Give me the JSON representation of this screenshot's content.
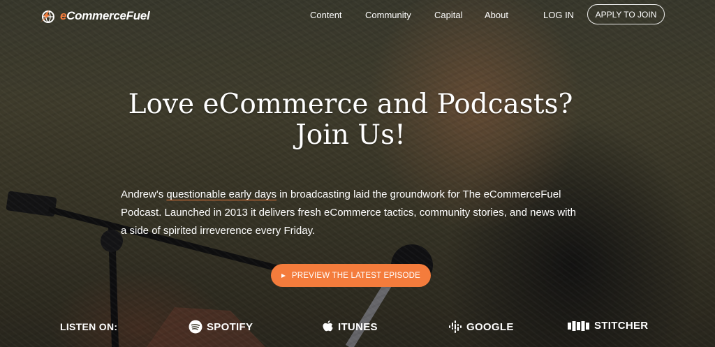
{
  "header": {
    "logo": {
      "prefix": "e",
      "rest": "CommerceFuel"
    },
    "nav": [
      "Content",
      "Community",
      "Capital",
      "About"
    ],
    "login": "LOG IN",
    "apply": "APPLY TO JOIN"
  },
  "hero": {
    "title_line1": "Love eCommerce and Podcasts?",
    "title_line2": "Join Us!",
    "description": {
      "before": "Andrew's ",
      "link": "questionable early days",
      "after": " in broadcasting laid the groundwork for The eCommerceFuel Podcast. Launched in 2013 it delivers fresh eCommerce tactics, community stories, and news with a side of spirited irreverence every Friday."
    },
    "cta": "PREVIEW THE LATEST EPISODE"
  },
  "listen": {
    "label": "LISTEN ON:",
    "platforms": [
      {
        "name": "SPOTIFY",
        "icon": "spotify-icon"
      },
      {
        "name": "ITUNES",
        "icon": "apple-icon"
      },
      {
        "name": "GOOGLE",
        "icon": "google-podcasts-icon"
      },
      {
        "name": "STITCHER",
        "icon": "stitcher-icon"
      }
    ]
  },
  "colors": {
    "accent": "#f47c3c"
  }
}
